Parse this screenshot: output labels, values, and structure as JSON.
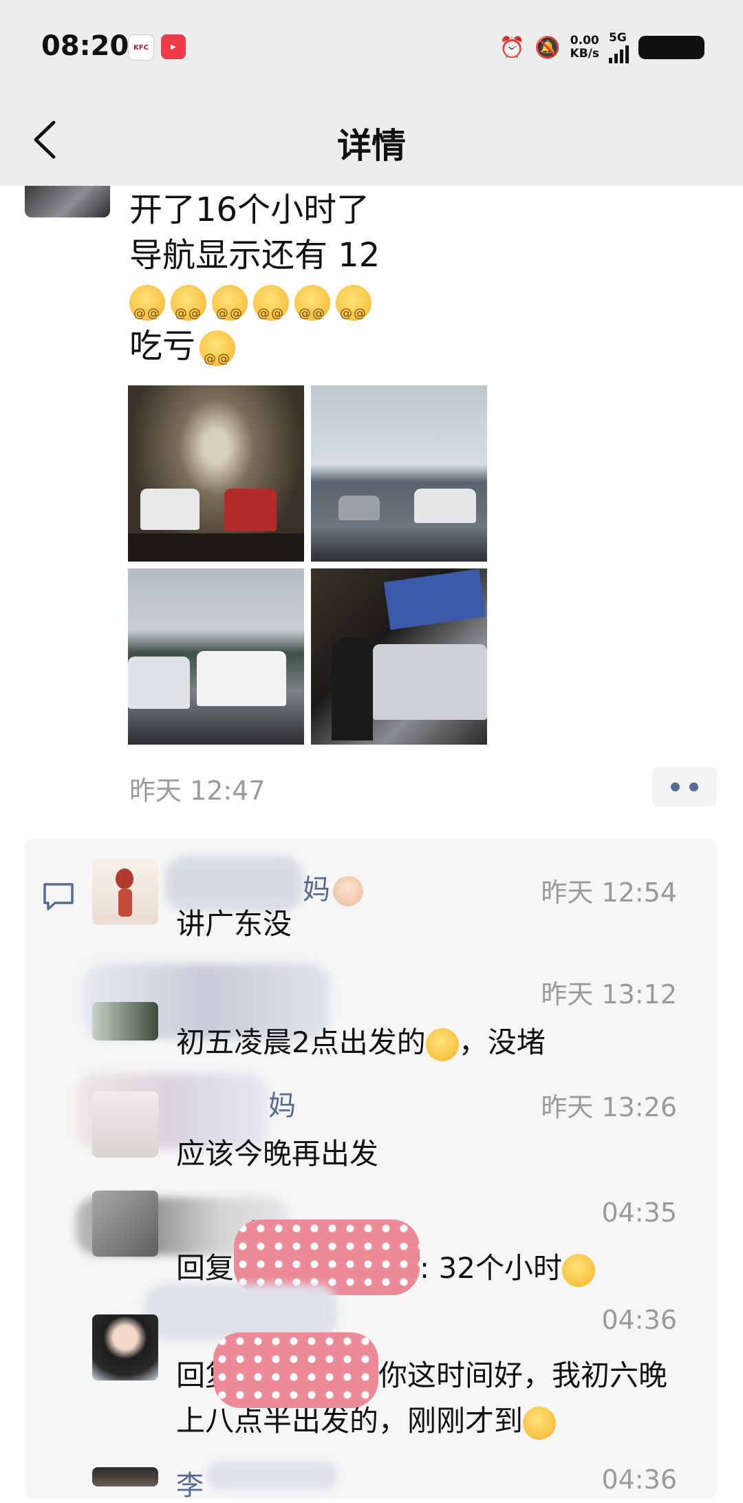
{
  "status_bar": {
    "time": "08:20",
    "net_speed": "0.00",
    "net_unit": "KB/s",
    "network": "5G"
  },
  "header": {
    "title": "详情"
  },
  "post": {
    "lines": [
      "开了16个小时了",
      "导航显示还有 12",
      "吃亏"
    ],
    "time": "昨天 12:47"
  },
  "comments": [
    {
      "name": "妈",
      "time": "昨天 12:54",
      "text": "讲广东没"
    },
    {
      "name": "",
      "time": "昨天 13:12",
      "text": "初五凌晨2点出发的",
      "text_suffix": "，没堵"
    },
    {
      "name": "妈",
      "time": "昨天 13:26",
      "text": "应该今晚再出发"
    },
    {
      "name": "妈妈",
      "time": "04:35",
      "text_prefix": "回复",
      "text": ": 32个小时"
    },
    {
      "name": "",
      "time": "04:36",
      "text_prefix": "回复",
      "text": "你这时间好，我初六晚",
      "text2": "上八点半出发的，刚刚才到"
    },
    {
      "name": "李",
      "time": "04:36"
    }
  ]
}
